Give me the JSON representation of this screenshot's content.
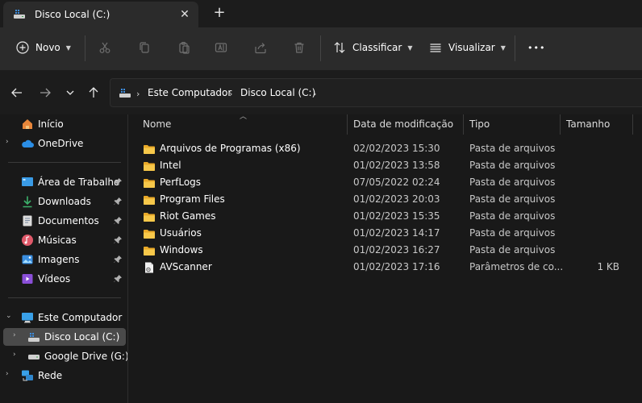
{
  "window": {
    "tab_title": "Disco Local (C:)",
    "close_tab_symbol": "✕",
    "new_tab_symbol": "+"
  },
  "commandbar": {
    "new_label": "Novo",
    "sort_label": "Classificar",
    "view_label": "Visualizar",
    "more_symbol": "•••",
    "icons": [
      "add-icon",
      "cut-icon",
      "copy-icon",
      "paste-icon",
      "rename-icon",
      "share-icon",
      "delete-icon",
      "sort-icon",
      "view-icon",
      "more-icon"
    ]
  },
  "address": {
    "crumbs": [
      "Este Computador",
      "Disco Local (C:)"
    ],
    "separator": "›"
  },
  "nav": {
    "quick": [
      {
        "label": "Início",
        "icon": "home-icon"
      },
      {
        "label": "OneDrive",
        "icon": "cloud-icon"
      }
    ],
    "pinned": [
      {
        "label": "Área de Trabalho",
        "icon": "desktop-icon"
      },
      {
        "label": "Downloads",
        "icon": "download-icon"
      },
      {
        "label": "Documentos",
        "icon": "documents-icon"
      },
      {
        "label": "Músicas",
        "icon": "music-icon"
      },
      {
        "label": "Imagens",
        "icon": "images-icon"
      },
      {
        "label": "Vídeos",
        "icon": "videos-icon"
      }
    ],
    "computer": {
      "label": "Este Computador",
      "icon": "computer-icon"
    },
    "drives": [
      {
        "label": "Disco Local (C:)",
        "icon": "drive-icon",
        "selected": true
      },
      {
        "label": "Google Drive (G:)",
        "icon": "drive-icon",
        "selected": false
      }
    ],
    "network": {
      "label": "Rede",
      "icon": "network-icon"
    }
  },
  "columns": [
    "Nome",
    "Data de modificação",
    "Tipo",
    "Tamanho"
  ],
  "files": [
    {
      "name": "Arquivos de Programas (x86)",
      "date": "02/02/2023 15:30",
      "type": "Pasta de arquivos",
      "size": "",
      "icon": "folder-icon"
    },
    {
      "name": "Intel",
      "date": "01/02/2023 13:58",
      "type": "Pasta de arquivos",
      "size": "",
      "icon": "folder-icon"
    },
    {
      "name": "PerfLogs",
      "date": "07/05/2022 02:24",
      "type": "Pasta de arquivos",
      "size": "",
      "icon": "folder-icon"
    },
    {
      "name": "Program Files",
      "date": "01/02/2023 20:03",
      "type": "Pasta de arquivos",
      "size": "",
      "icon": "folder-icon"
    },
    {
      "name": "Riot Games",
      "date": "01/02/2023 15:35",
      "type": "Pasta de arquivos",
      "size": "",
      "icon": "folder-icon"
    },
    {
      "name": "Usuários",
      "date": "01/02/2023 14:17",
      "type": "Pasta de arquivos",
      "size": "",
      "icon": "folder-icon"
    },
    {
      "name": "Windows",
      "date": "01/02/2023 16:27",
      "type": "Pasta de arquivos",
      "size": "",
      "icon": "folder-icon"
    },
    {
      "name": "AVScanner",
      "date": "01/02/2023 17:16",
      "type": "Parâmetros de co...",
      "size": "1 KB",
      "icon": "settings-file-icon"
    }
  ],
  "colors": {
    "folder": "#f5c542",
    "accent": "#4aa3ff"
  }
}
